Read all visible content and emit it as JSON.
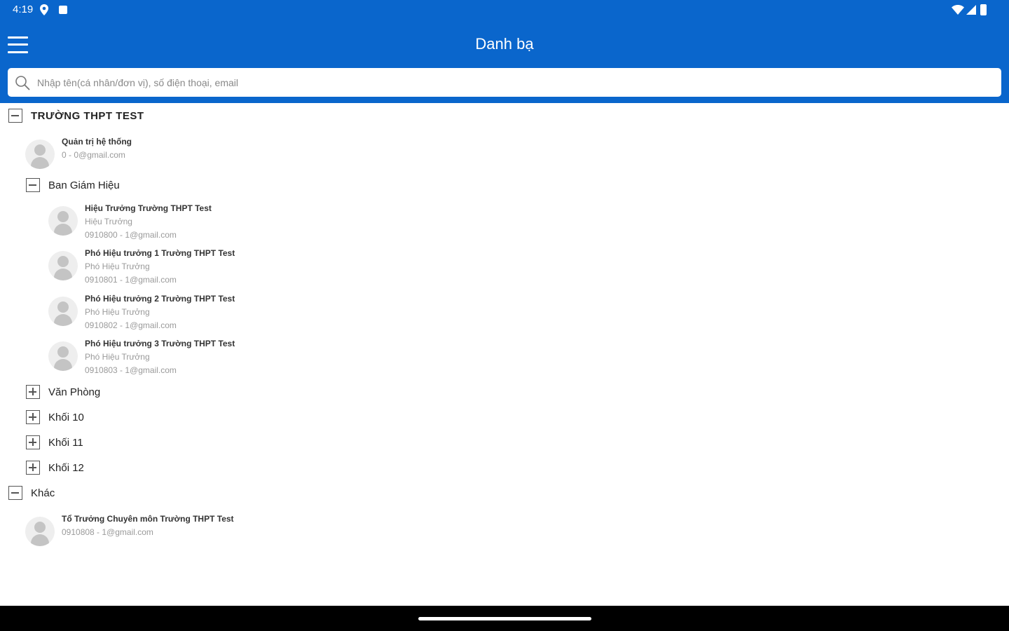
{
  "status_bar": {
    "time": "4:19"
  },
  "header": {
    "title": "Danh bạ"
  },
  "search": {
    "placeholder": "Nhập tên(cá nhân/đơn vị), số điện thoại, email"
  },
  "tree": {
    "root": {
      "label": "TRƯỜNG THPT TEST",
      "contacts": [
        {
          "name": "Quản trị hệ thống",
          "detail": "0 - 0@gmail.com"
        }
      ],
      "groups": [
        {
          "label": "Ban Giám Hiệu",
          "contacts": [
            {
              "name": "Hiệu Trưởng Trường THPT Test",
              "role": "Hiệu Trưởng",
              "detail": "0910800 - 1@gmail.com"
            },
            {
              "name": "Phó Hiệu trưởng 1 Trường THPT Test",
              "role": "Phó Hiệu Trưởng",
              "detail": "0910801 - 1@gmail.com"
            },
            {
              "name": "Phó Hiệu trưởng 2 Trường THPT Test",
              "role": "Phó Hiệu Trưởng",
              "detail": "0910802 - 1@gmail.com"
            },
            {
              "name": "Phó Hiệu trưởng 3 Trường THPT Test",
              "role": "Phó Hiệu Trưởng",
              "detail": "0910803 - 1@gmail.com"
            }
          ]
        },
        {
          "label": "Văn Phòng"
        },
        {
          "label": "Khối 10"
        },
        {
          "label": "Khối 11"
        },
        {
          "label": "Khối 12"
        }
      ]
    },
    "other": {
      "label": "Khác",
      "contacts": [
        {
          "name": "Tổ Trưởng Chuyên môn Trường THPT Test",
          "detail": "0910808 - 1@gmail.com"
        }
      ]
    }
  }
}
